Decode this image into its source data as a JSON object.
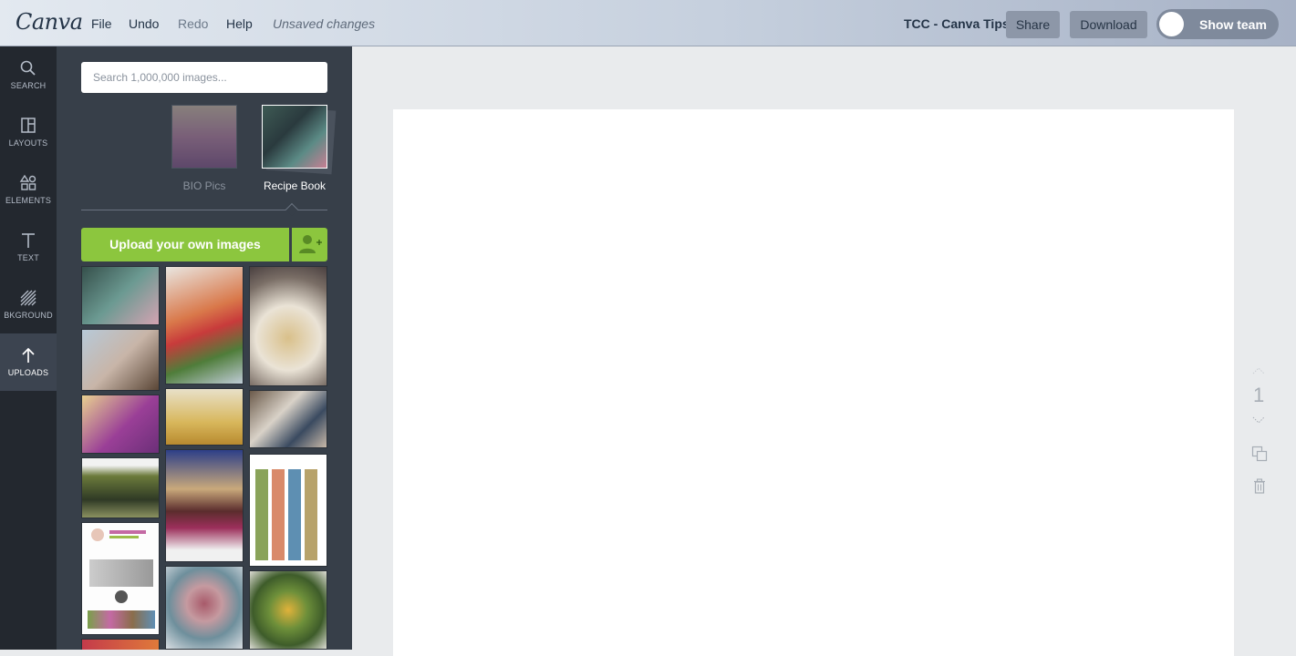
{
  "topbar": {
    "logo": "Canva",
    "menu": [
      "File",
      "Undo",
      "Redo",
      "Help"
    ],
    "status": "Unsaved changes",
    "doc_title": "TCC - Canva Tips",
    "share": "Share",
    "download": "Download",
    "toggle_label": "Show team"
  },
  "nav": [
    {
      "label": "SEARCH",
      "icon": "search-icon"
    },
    {
      "label": "LAYOUTS",
      "icon": "layouts-icon"
    },
    {
      "label": "ELEMENTS",
      "icon": "elements-icon"
    },
    {
      "label": "TEXT",
      "icon": "text-icon"
    },
    {
      "label": "BKGROUND",
      "icon": "background-icon"
    },
    {
      "label": "UPLOADS",
      "icon": "upload-icon",
      "active": true
    }
  ],
  "panel": {
    "search_placeholder": "Search 1,000,000 images...",
    "folders": [
      {
        "label": "BIO Pics",
        "selected": false
      },
      {
        "label": "Recipe Book",
        "selected": true
      }
    ],
    "upload_label": "Upload your own images"
  },
  "canvas": {
    "page_number": "1"
  },
  "colors": {
    "accent": "#8cc63e",
    "sidebar": "#23282f",
    "panel": "#373f49"
  }
}
